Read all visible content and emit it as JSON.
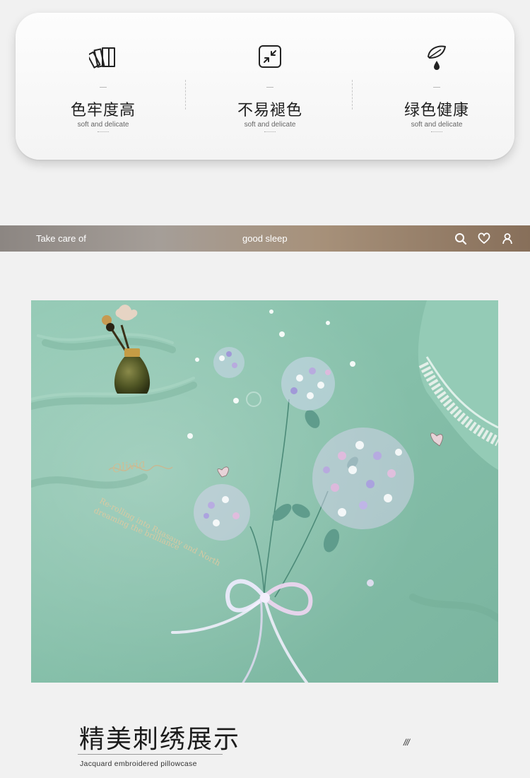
{
  "features": [
    {
      "icon": "color-swatch-icon",
      "title": "色牢度高",
      "subtitle": "soft and delicate"
    },
    {
      "icon": "shrink-arrows-icon",
      "title": "不易褪色",
      "subtitle": "soft and delicate"
    },
    {
      "icon": "leaf-drop-icon",
      "title": "绿色健康",
      "subtitle": "soft and delicate"
    }
  ],
  "banner": {
    "left_text": "Take care of",
    "center_text": "good sleep",
    "icons": [
      "search-icon",
      "heart-icon",
      "user-icon"
    ],
    "gradient": [
      "#8c8682",
      "#a7917a",
      "#876f5a"
    ]
  },
  "photo": {
    "embroidery_text": [
      "Olivia",
      "Re-rolling into Ruasauv and North",
      "dreaming the brilliance"
    ],
    "fabric_color": "#86c0ab"
  },
  "section": {
    "title": "精美刺绣展示",
    "subtitle": "Jacquard embroidered pillowcase",
    "decoration": "///"
  }
}
